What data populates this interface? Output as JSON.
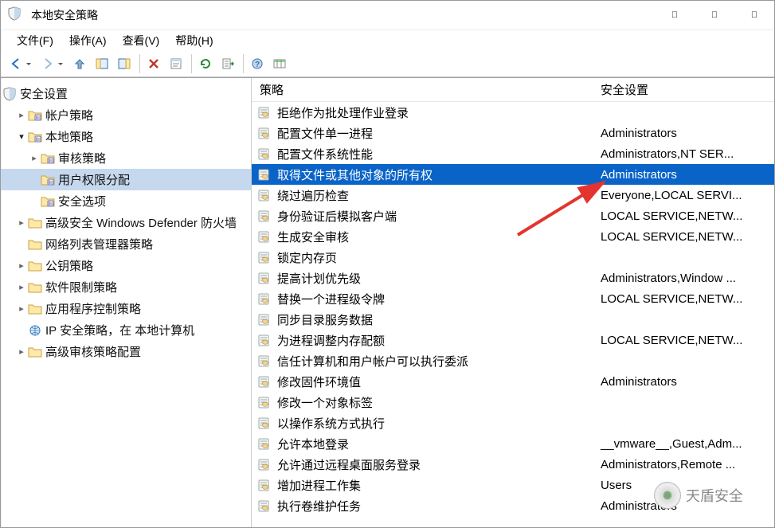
{
  "window": {
    "title": "本地安全策略"
  },
  "menu": {
    "file": "文件(F)",
    "action": "操作(A)",
    "view": "查看(V)",
    "help": "帮助(H)"
  },
  "toolbar_icons": {
    "back": "back-icon",
    "forward": "forward-icon",
    "up": "up-icon",
    "showhide": "showhide-icon",
    "delete": "delete-icon",
    "properties": "properties-icon",
    "refresh": "refresh-icon",
    "export": "export-icon",
    "help": "help-icon",
    "grid": "grid-icon"
  },
  "tree": {
    "root": "安全设置",
    "items": [
      {
        "label": "帐户策略",
        "icon": "folder-policy",
        "depth": 1,
        "expand": "closed"
      },
      {
        "label": "本地策略",
        "icon": "folder-policy",
        "depth": 1,
        "expand": "open"
      },
      {
        "label": "审核策略",
        "icon": "folder-policy",
        "depth": 2,
        "expand": "closed"
      },
      {
        "label": "用户权限分配",
        "icon": "folder-policy",
        "depth": 2,
        "selected": true
      },
      {
        "label": "安全选项",
        "icon": "folder-policy",
        "depth": 2
      },
      {
        "label": "高级安全 Windows Defender 防火墙",
        "icon": "folder",
        "depth": 1,
        "expand": "closed"
      },
      {
        "label": "网络列表管理器策略",
        "icon": "folder",
        "depth": 1
      },
      {
        "label": "公钥策略",
        "icon": "folder",
        "depth": 1,
        "expand": "closed"
      },
      {
        "label": "软件限制策略",
        "icon": "folder",
        "depth": 1,
        "expand": "closed"
      },
      {
        "label": "应用程序控制策略",
        "icon": "folder",
        "depth": 1,
        "expand": "closed"
      },
      {
        "label": "IP 安全策略，在 本地计算机",
        "icon": "ip",
        "depth": 1
      },
      {
        "label": "高级审核策略配置",
        "icon": "folder",
        "depth": 1,
        "expand": "closed"
      }
    ]
  },
  "list": {
    "columns": {
      "policy": "策略",
      "setting": "安全设置"
    },
    "rows": [
      {
        "policy": "拒绝作为批处理作业登录",
        "setting": ""
      },
      {
        "policy": "配置文件单一进程",
        "setting": "Administrators"
      },
      {
        "policy": "配置文件系统性能",
        "setting": "Administrators,NT SER..."
      },
      {
        "policy": "取得文件或其他对象的所有权",
        "setting": "Administrators",
        "selected": true
      },
      {
        "policy": "绕过遍历检查",
        "setting": "Everyone,LOCAL SERVI..."
      },
      {
        "policy": "身份验证后模拟客户端",
        "setting": "LOCAL SERVICE,NETW..."
      },
      {
        "policy": "生成安全审核",
        "setting": "LOCAL SERVICE,NETW..."
      },
      {
        "policy": "锁定内存页",
        "setting": ""
      },
      {
        "policy": "提高计划优先级",
        "setting": "Administrators,Window ..."
      },
      {
        "policy": "替换一个进程级令牌",
        "setting": "LOCAL SERVICE,NETW..."
      },
      {
        "policy": "同步目录服务数据",
        "setting": ""
      },
      {
        "policy": "为进程调整内存配额",
        "setting": "LOCAL SERVICE,NETW..."
      },
      {
        "policy": "信任计算机和用户帐户可以执行委派",
        "setting": ""
      },
      {
        "policy": "修改固件环境值",
        "setting": "Administrators"
      },
      {
        "policy": "修改一个对象标签",
        "setting": ""
      },
      {
        "policy": "以操作系统方式执行",
        "setting": ""
      },
      {
        "policy": "允许本地登录",
        "setting": "__vmware__,Guest,Adm..."
      },
      {
        "policy": "允许通过远程桌面服务登录",
        "setting": "Administrators,Remote ..."
      },
      {
        "policy": "增加进程工作集",
        "setting": "Users"
      },
      {
        "policy": "执行卷维护任务",
        "setting": "Administrators"
      }
    ]
  },
  "watermark": {
    "text": "天盾安全"
  }
}
